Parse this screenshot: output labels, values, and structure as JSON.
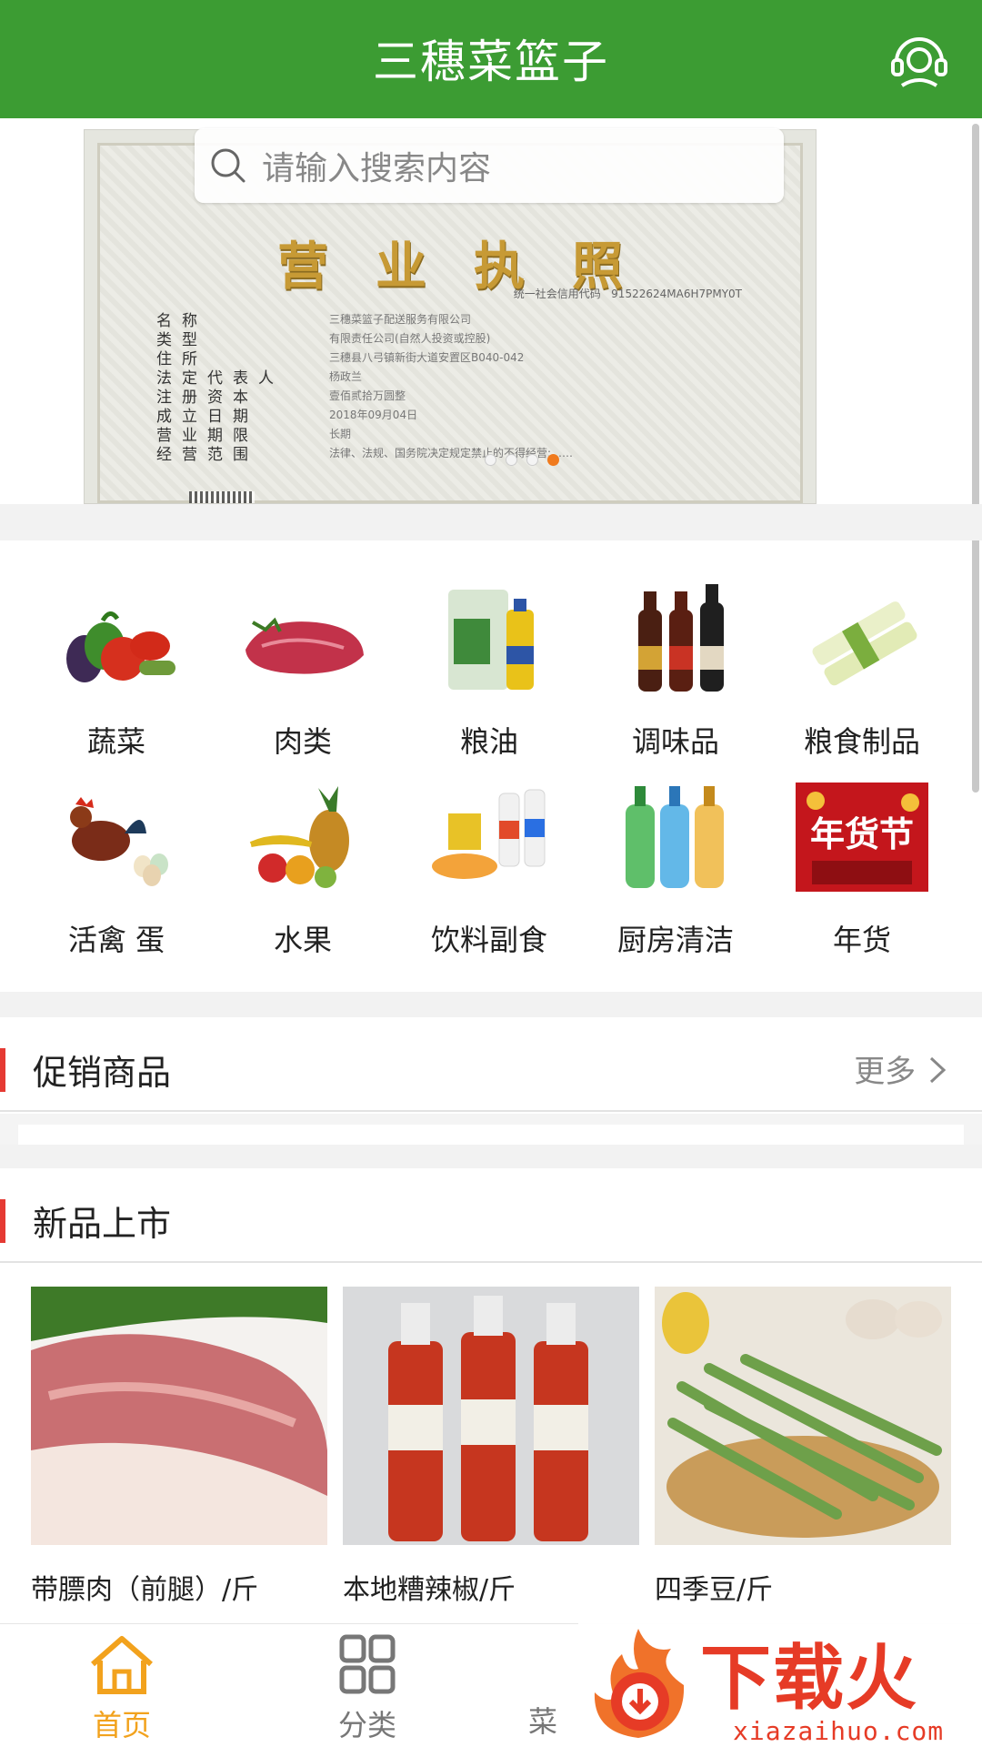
{
  "app": {
    "title": "三穗菜篮子"
  },
  "search": {
    "placeholder": "请输入搜索内容"
  },
  "banner": {
    "title": "营业执照",
    "code_label": "统一社会信用代码",
    "code_value": "91522624MA6H7PMY0T",
    "rows": [
      {
        "key": "名称",
        "value": "三穗菜篮子配送服务有限公司"
      },
      {
        "key": "类型",
        "value": "有限责任公司(自然人投资或控股)"
      },
      {
        "key": "住所",
        "value": "三穗县八弓镇新街大道安置区B040-042"
      },
      {
        "key": "法定代表人",
        "value": "杨政兰"
      },
      {
        "key": "注册资本",
        "value": "壹佰贰拾万圆整"
      },
      {
        "key": "成立日期",
        "value": "2018年09月04日"
      },
      {
        "key": "营业期限",
        "value": "长期"
      },
      {
        "key": "经营范围",
        "value": "法律、法规、国务院决定规定禁止的不得经营;……"
      }
    ],
    "active_slide": 3,
    "slides": 4
  },
  "categories": [
    {
      "label": "蔬菜",
      "icon": "vegetables-icon"
    },
    {
      "label": "肉类",
      "icon": "meat-icon"
    },
    {
      "label": "粮油",
      "icon": "grain-oil-icon"
    },
    {
      "label": "调味品",
      "icon": "seasoning-icon"
    },
    {
      "label": "粮食制品",
      "icon": "noodles-icon"
    },
    {
      "label": "活禽 蛋",
      "icon": "poultry-egg-icon"
    },
    {
      "label": "水果",
      "icon": "fruit-icon"
    },
    {
      "label": "饮料副食",
      "icon": "drinks-snacks-icon"
    },
    {
      "label": "厨房清洁",
      "icon": "kitchen-cleaning-icon"
    },
    {
      "label": "年货",
      "icon": "new-year-goods-icon"
    }
  ],
  "promo": {
    "title": "促销商品",
    "more": "更多"
  },
  "newArrivals": {
    "title": "新品上市",
    "products": [
      {
        "name": "带膘肉（前腿）/斤"
      },
      {
        "name": "本地糟辣椒/斤"
      },
      {
        "name": "四季豆/斤"
      }
    ]
  },
  "tabs": [
    {
      "label": "首页",
      "icon": "home-icon",
      "active": true
    },
    {
      "label": "分类",
      "icon": "category-grid-icon",
      "active": false
    },
    {
      "label": "菜",
      "icon": "basket-icon",
      "active": false
    }
  ],
  "watermark": {
    "text": "下载火",
    "url": "xiazaihuo.com"
  },
  "colors": {
    "brand": "#3c9c33",
    "accent": "#f2a21d",
    "section_bar": "#e53a33"
  }
}
